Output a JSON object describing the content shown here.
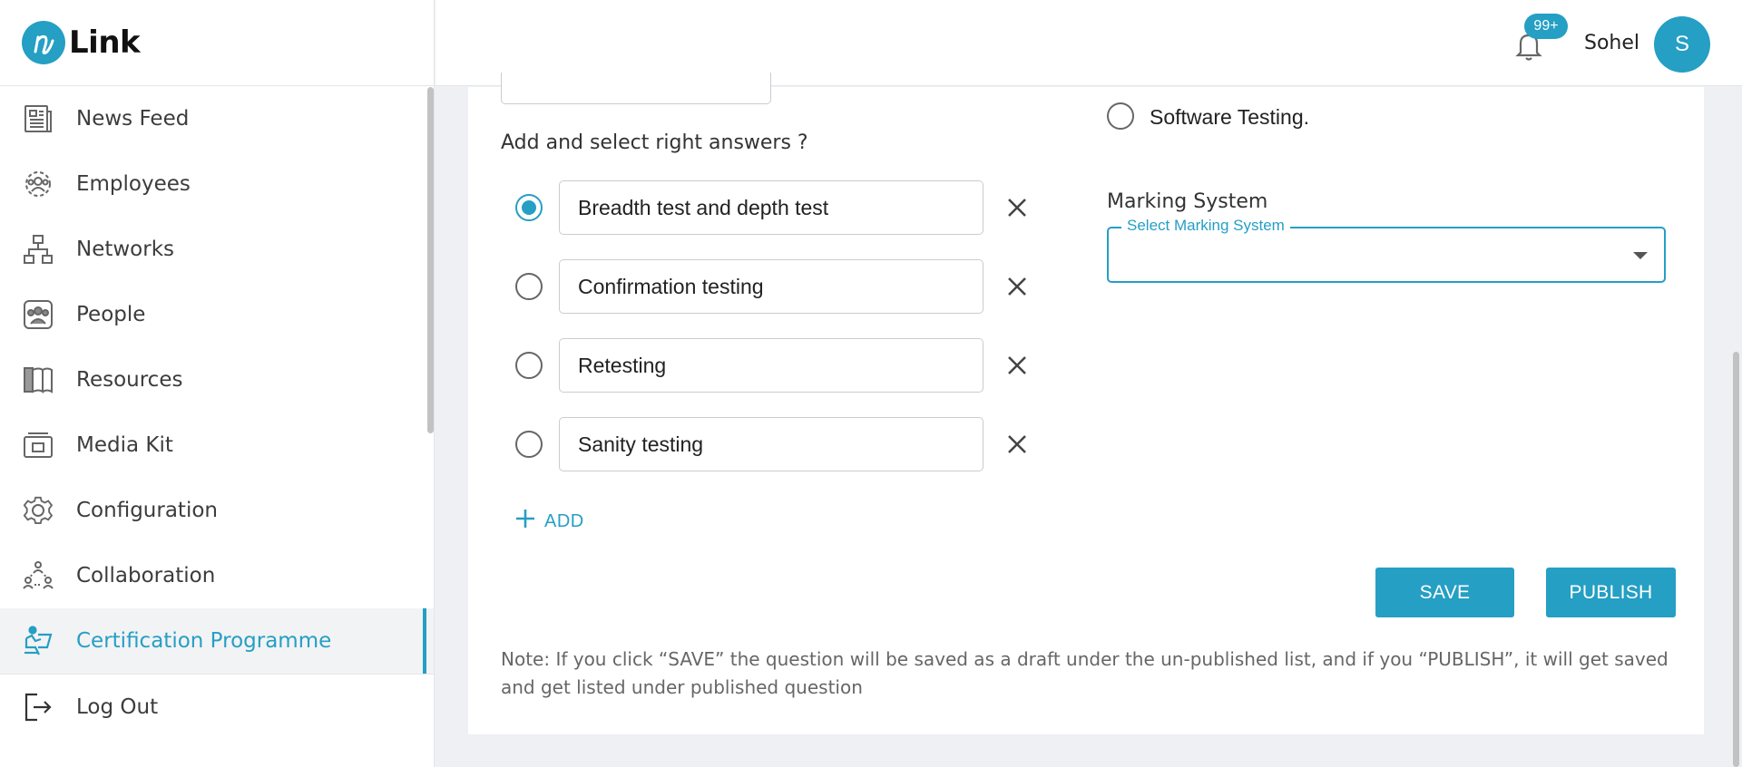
{
  "brand": {
    "name": "Link",
    "mark": "n"
  },
  "sidebar": {
    "items": [
      {
        "label": "News Feed",
        "icon": "newspaper-icon"
      },
      {
        "label": "Employees",
        "icon": "employees-icon"
      },
      {
        "label": "Networks",
        "icon": "network-icon"
      },
      {
        "label": "People",
        "icon": "people-icon"
      },
      {
        "label": "Resources",
        "icon": "book-icon"
      },
      {
        "label": "Media Kit",
        "icon": "media-kit-icon"
      },
      {
        "label": "Configuration",
        "icon": "gear-icon"
      },
      {
        "label": "Collaboration",
        "icon": "collaboration-icon"
      },
      {
        "label": "Certification Programme",
        "icon": "certification-icon",
        "active": true
      },
      {
        "label": "Log Out",
        "icon": "logout-icon"
      }
    ]
  },
  "header": {
    "notifications_badge": "99+",
    "user_name": "Sohel",
    "avatar_initial": "S"
  },
  "form": {
    "answers_label": "Add and select right answers ?",
    "answers": [
      {
        "value": "Breadth test and depth test",
        "selected": true
      },
      {
        "value": "Confirmation testing",
        "selected": false
      },
      {
        "value": "Retesting",
        "selected": false
      },
      {
        "value": "Sanity testing",
        "selected": false
      }
    ],
    "add_label": "ADD",
    "category_option": "Software Testing.",
    "marking_label": "Marking System",
    "marking_select_legend": "Select Marking System",
    "marking_select_value": "",
    "save_label": "SAVE",
    "publish_label": "PUBLISH",
    "note": "Note: If you click “SAVE” the question will be saved as a draft under the un-published list, and if you “PUBLISH”, it will get saved and get listed under published question"
  },
  "colors": {
    "accent": "#259fc4",
    "background": "#eef0f4"
  }
}
